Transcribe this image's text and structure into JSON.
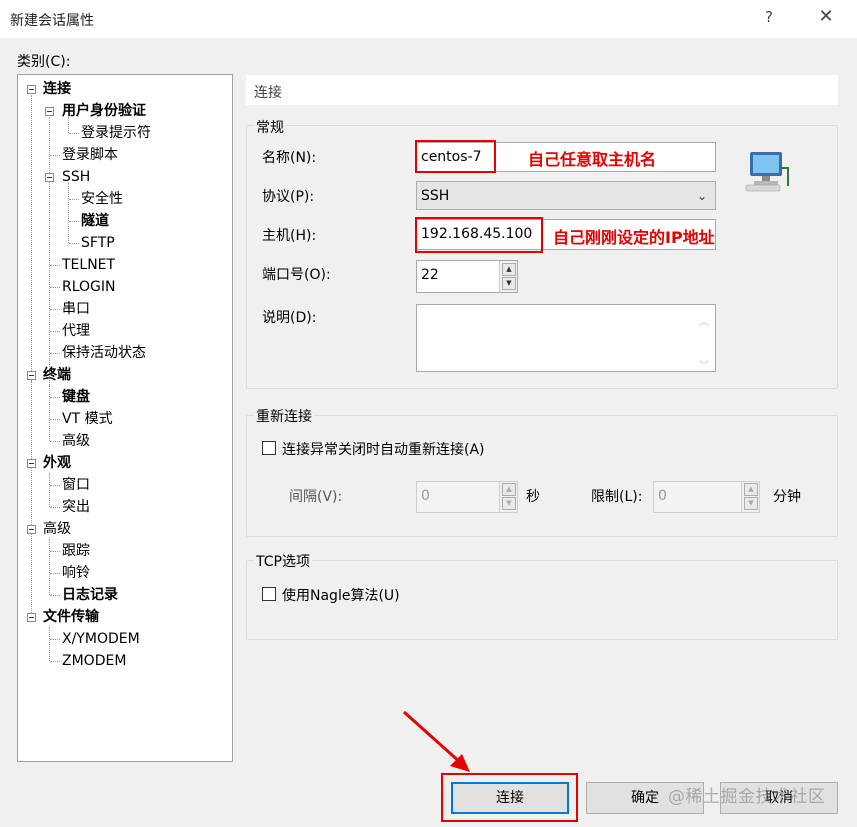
{
  "window": {
    "title": "新建会话属性",
    "help": "?",
    "close": "✕"
  },
  "category_label": "类别(C):",
  "tree": {
    "items": [
      {
        "label": "连接",
        "bold": true
      },
      {
        "label": "用户身份验证",
        "bold": true
      },
      {
        "label": "登录提示符"
      },
      {
        "label": "登录脚本"
      },
      {
        "label": "SSH"
      },
      {
        "label": "安全性"
      },
      {
        "label": "隧道",
        "bold": true
      },
      {
        "label": "SFTP"
      },
      {
        "label": "TELNET"
      },
      {
        "label": "RLOGIN"
      },
      {
        "label": "串口"
      },
      {
        "label": "代理"
      },
      {
        "label": "保持活动状态"
      },
      {
        "label": "终端",
        "bold": true
      },
      {
        "label": "键盘",
        "bold": true
      },
      {
        "label": "VT 模式"
      },
      {
        "label": "高级"
      },
      {
        "label": "外观",
        "bold": true
      },
      {
        "label": "窗口"
      },
      {
        "label": "突出"
      },
      {
        "label": "高级"
      },
      {
        "label": "跟踪"
      },
      {
        "label": "响铃"
      },
      {
        "label": "日志记录",
        "bold": true
      },
      {
        "label": "文件传输",
        "bold": true
      },
      {
        "label": "X/YMODEM"
      },
      {
        "label": "ZMODEM"
      }
    ]
  },
  "page_title": "连接",
  "general": {
    "title": "常规",
    "name_label": "名称(N):",
    "name_value": "centos-7",
    "name_note": "自己任意取主机名",
    "protocol_label": "协议(P):",
    "protocol_value": "SSH",
    "host_label": "主机(H):",
    "host_value": "192.168.45.100",
    "host_note": "自己刚刚设定的IP地址",
    "port_label": "端口号(O):",
    "port_value": "22",
    "desc_label": "说明(D):",
    "desc_value": ""
  },
  "reconnect": {
    "title": "重新连接",
    "checkbox_label": "连接异常关闭时自动重新连接(A)",
    "checked": false,
    "interval_label": "间隔(V):",
    "interval_value": "0",
    "interval_unit": "秒",
    "limit_label": "限制(L):",
    "limit_value": "0",
    "limit_unit": "分钟"
  },
  "tcp": {
    "title": "TCP选项",
    "checkbox_label": "使用Nagle算法(U)",
    "checked": false
  },
  "buttons": {
    "connect": "连接",
    "ok": "确定",
    "cancel": "取消"
  },
  "watermark": "@稀土掘金技术社区",
  "colors": {
    "annotation_red": "#e60000",
    "focus_blue": "#0078d7"
  }
}
